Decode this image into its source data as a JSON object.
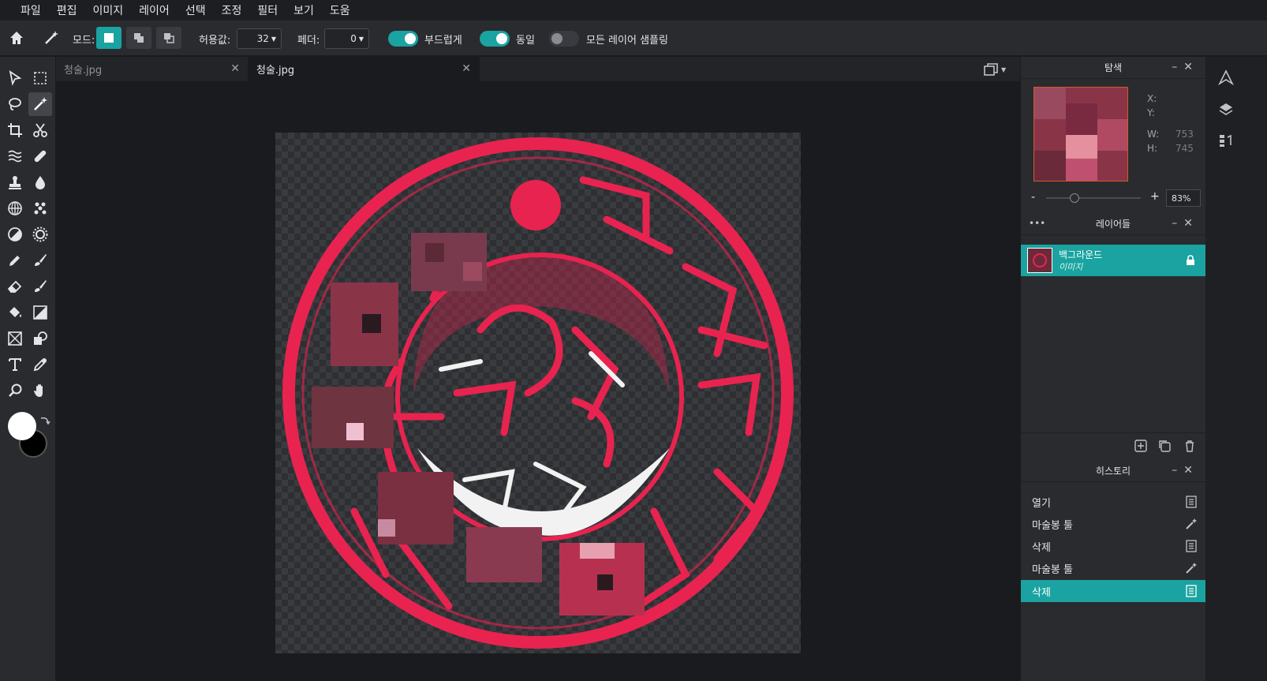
{
  "menu": [
    "파일",
    "편집",
    "이미지",
    "레이어",
    "선택",
    "조정",
    "필터",
    "보기",
    "도움"
  ],
  "options": {
    "mode_label": "모드:",
    "tolerance_label": "허용값:",
    "tolerance_value": "32",
    "feather_label": "페더:",
    "feather_value": "0",
    "smooth_label": "부드럽게",
    "contiguous_label": "동일",
    "sample_all_label": "모든 레이어 샘플링"
  },
  "tabs": [
    {
      "label": "청술.jpg",
      "active": false
    },
    {
      "label": "청술.jpg",
      "active": true
    }
  ],
  "navigator": {
    "title": "탐색",
    "x_label": "X:",
    "y_label": "Y:",
    "w_label": "W:",
    "w_value": "753",
    "h_label": "H:",
    "h_value": "745",
    "zoom_minus": "-",
    "zoom_plus": "+",
    "zoom_value": "83%",
    "zoom_level": 0.3
  },
  "layers": {
    "title": "레이어들",
    "more": "•••",
    "items": [
      {
        "name": "백그라운드",
        "type": "이미지",
        "locked": true
      }
    ]
  },
  "history": {
    "title": "히스토리",
    "items": [
      {
        "label": "열기",
        "icon": "document-icon",
        "active": false
      },
      {
        "label": "마술봉 툴",
        "icon": "magic-wand-icon",
        "active": false
      },
      {
        "label": "삭제",
        "icon": "document-icon",
        "active": false
      },
      {
        "label": "마술봉 툴",
        "icon": "magic-wand-icon",
        "active": false
      },
      {
        "label": "삭제",
        "icon": "document-icon",
        "active": true
      }
    ]
  },
  "colors": {
    "accent": "#1aa3a0",
    "stamp_red": "#e8234f",
    "foreground": "#ffffff",
    "background": "#000000"
  }
}
